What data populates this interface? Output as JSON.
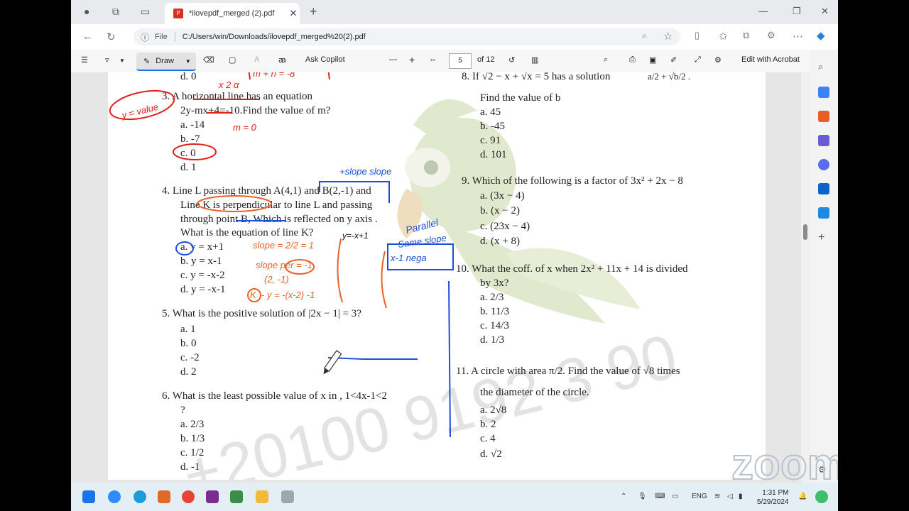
{
  "browser": {
    "tab_title": "*ilovepdf_merged (2).pdf",
    "tab_close": "✕",
    "new_tab": "+",
    "win_min": "—",
    "win_restore": "❐",
    "win_close": "✕",
    "address_label": "File",
    "address_url": "C:/Users/win/Downloads/ilovepdf_merged%20(2).pdf"
  },
  "pdf_toolbar": {
    "draw_label": "Draw",
    "ask_copilot": "Ask Copilot",
    "zoom_out": "—",
    "zoom_in": "+",
    "page_current": "5",
    "page_total": "of 12",
    "edit_acrobat": "Edit with Acrobat"
  },
  "doc": {
    "q2_tail": "d.   0",
    "q3_text": "3.   A horizontal line has an equation",
    "q3_eq": "2y-mx+4=-10.Find the value of m?",
    "q3_a": "a.    -14",
    "q3_b": "b.    -7",
    "q3_c": "c.    0",
    "q3_d": "d.   1",
    "q4_l1": "4.   Line L passing through A(4,1) and B(2,-1) and",
    "q4_l2": "Line K is perpendicular to line L and passing",
    "q4_l3": "through point B, Which is reflected on y axis .",
    "q4_l4": "What is the equation of line K?",
    "q4_a": "a.    y = x+1",
    "q4_b": "b.    y = x-1",
    "q4_c": "c.    y = -x-2",
    "q4_d": "d.    y = -x-1",
    "q5_text": "5.   What is the positive solution of |2x − 1| = 3?",
    "q5_a": "a.    1",
    "q5_b": "b.    0",
    "q5_c": "c.    -2",
    "q5_d": "d.    2",
    "q6_text": "6.   What is the least possible value of x in , 1<4x-1<2",
    "q6_q": "?",
    "q6_a": "a.    2/3",
    "q6_b": "b.    1/3",
    "q6_c": "c.    1/2",
    "q6_d": "d.    -1",
    "q8_text": "8.   If √2 − x + √x  = 5 has a solution",
    "q8_frac": "a/2 + √b/2 .",
    "q8_sub": "Find the value of b",
    "q8_a": "a.    45",
    "q8_b": "b.    -45",
    "q8_c": "c.    91",
    "q8_d": "d.    101",
    "q9_text": "9.   Which of the following is a factor of  3x² + 2x − 8",
    "q9_a": "a.    (3x − 4)",
    "q9_b": "b.    (x − 2)",
    "q9_c": "c.    (23x − 4)",
    "q9_d": "d.    (x + 8)",
    "q10_text": "10.   What the coff. of x when 2x² + 11x + 14 is divided",
    "q10_sub": "by 3x?",
    "q10_a": "a.    2/3",
    "q10_b": "b.    11/3",
    "q10_c": "c.    14/3",
    "q10_d": "d.    1/3",
    "q11_text": "11.   A circle with area π/2. Find the value of √8 times",
    "q11_sub": "the diameter of the circle.",
    "q11_a": "a.    2√8",
    "q11_b": "b.    2",
    "q11_c": "c.    4",
    "q11_d": "d.    √2",
    "watermark": "+20100 9192 3 90"
  },
  "annotations": {
    "eq_top": "m + n = -8",
    "horizontal_note": "x 2 α",
    "y_value": "y = value",
    "m_zero": "m = 0",
    "slope_slope": "+slope slope",
    "parallel": "Parallel",
    "same_slope": "Same slope",
    "x_neg": "x-1 nega",
    "y_eq": "y=-x+1",
    "slope_calc": "slope = 2/2 = 1",
    "slope_perp": "slope per = -1",
    "point": "(2, -1)",
    "k_eq": "K :- y = -(x-2) -1"
  },
  "taskbar": {
    "lang": "ENG",
    "time": "1:31 PM",
    "date": "5/29/2024"
  },
  "overlay": {
    "zoom_logo": "zoom"
  },
  "colors": {
    "annotation_red": "#e0201c",
    "annotation_blue": "#1f4fd8",
    "annotation_orange": "#e8622a",
    "parrot_green": "#c8d7a5"
  }
}
